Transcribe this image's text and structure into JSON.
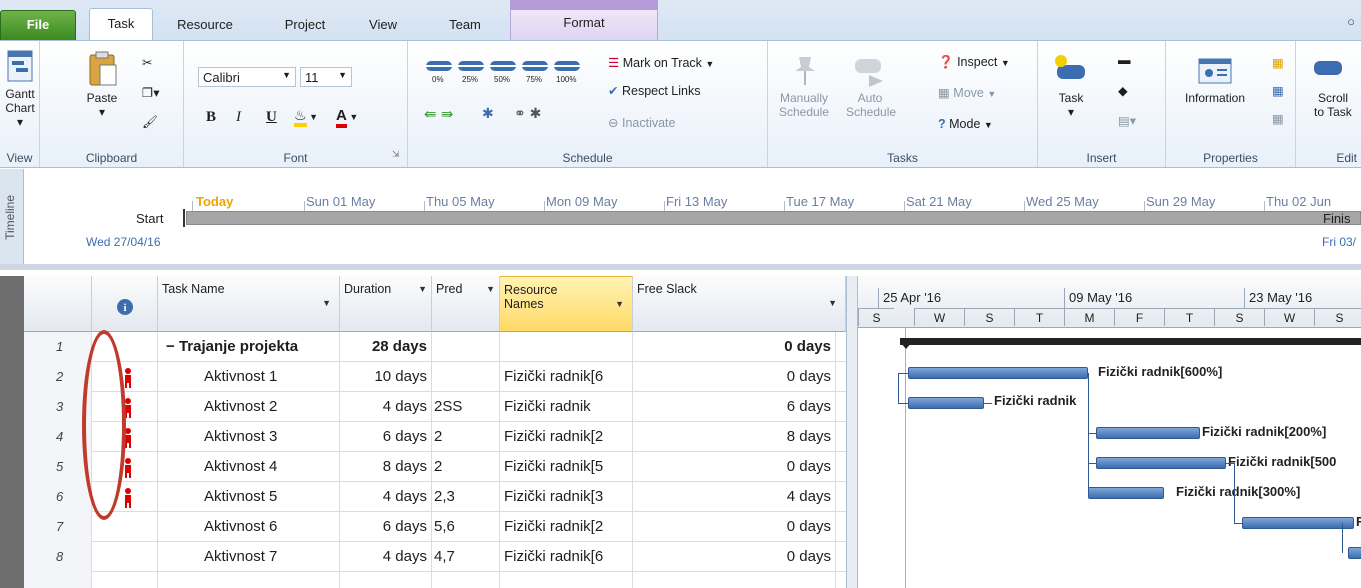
{
  "tabs": {
    "file": "File",
    "task": "Task",
    "resource": "Resource",
    "project": "Project",
    "view": "View",
    "team": "Team",
    "format": "Format"
  },
  "ribbon": {
    "view": {
      "gantt_line1": "Gantt",
      "gantt_line2": "Chart ▾",
      "label": "View"
    },
    "clipboard": {
      "paste": "Paste",
      "paste_arrow": "▾",
      "label": "Clipboard"
    },
    "font": {
      "name": "Calibri",
      "size": "11",
      "bold": "B",
      "italic": "I",
      "underline": "U",
      "color_a": "A",
      "label": "Font"
    },
    "schedule": {
      "pct": [
        "0%",
        "25%",
        "50%",
        "75%",
        "100%"
      ],
      "mark_on_track": "Mark on Track",
      "respect_links": "Respect Links",
      "inactivate": "Inactivate",
      "label": "Schedule"
    },
    "tasks": {
      "manually_line1": "Manually",
      "manually_line2": "Schedule",
      "auto_line1": "Auto",
      "auto_line2": "Schedule",
      "inspect": "Inspect",
      "move": "Move",
      "mode": "Mode",
      "label": "Tasks"
    },
    "insert": {
      "task": "Task",
      "task_arrow": "▾",
      "label": "Insert"
    },
    "properties": {
      "information": "Information",
      "label": "Properties"
    },
    "editing": {
      "scroll_line1": "Scroll",
      "scroll_line2": "to Task",
      "label": "Edit"
    }
  },
  "timeline": {
    "side_label": "Timeline",
    "start_label": "Start",
    "start_date": "Wed 27/04/16",
    "finish_label": "Finis",
    "finish_date": "Fri 03/",
    "today": "Today",
    "dates": [
      "Sun 01 May",
      "Thu 05 May",
      "Mon 09 May",
      "Fri 13 May",
      "Tue 17 May",
      "Sat 21 May",
      "Wed 25 May",
      "Sun 29 May",
      "Thu 02 Jun"
    ]
  },
  "grid": {
    "headers": {
      "task_name": "Task Name",
      "duration": "Duration",
      "pred": "Pred",
      "resource_line1": "Resource",
      "resource_line2": "Names",
      "free_slack": "Free Slack"
    },
    "rows": [
      {
        "id": "1",
        "name": "Trajanje projekta",
        "duration": "28 days",
        "pred": "",
        "resource": "",
        "slack": "0 days",
        "summary": true,
        "collapse": "−"
      },
      {
        "id": "2",
        "name": "Aktivnost 1",
        "duration": "10 days",
        "pred": "",
        "resource": "Fizički radnik[6",
        "slack": "0 days"
      },
      {
        "id": "3",
        "name": "Aktivnost 2",
        "duration": "4 days",
        "pred": "2SS",
        "resource": "Fizički radnik",
        "slack": "6 days"
      },
      {
        "id": "4",
        "name": "Aktivnost 3",
        "duration": "6 days",
        "pred": "2",
        "resource": "Fizički radnik[2",
        "slack": "8 days"
      },
      {
        "id": "5",
        "name": "Aktivnost 4",
        "duration": "8 days",
        "pred": "2",
        "resource": "Fizički radnik[5",
        "slack": "0 days"
      },
      {
        "id": "6",
        "name": "Aktivnost 5",
        "duration": "4 days",
        "pred": "2,3",
        "resource": "Fizički radnik[3",
        "slack": "4 days"
      },
      {
        "id": "7",
        "name": "Aktivnost 6",
        "duration": "6 days",
        "pred": "5,6",
        "resource": "Fizički radnik[2",
        "slack": "0 days"
      },
      {
        "id": "8",
        "name": "Aktivnost 7",
        "duration": "4 days",
        "pred": "4,7",
        "resource": "Fizički radnik[6",
        "slack": "0 days"
      }
    ]
  },
  "gantt": {
    "weeks": [
      "25 Apr '16",
      "09 May '16",
      "23 May '16"
    ],
    "days": [
      "S",
      "W",
      "S",
      "T",
      "M",
      "F",
      "T",
      "S",
      "W",
      "S"
    ],
    "labels": [
      "Fizički radnik[600%]",
      "Fizički radnik",
      "Fizički radnik[200%]",
      "Fizički radnik[500",
      "Fizički radnik[300%]",
      "F"
    ]
  },
  "colors": {
    "accent": "#3c6db0",
    "file_tab": "#3a8a20",
    "today": "#f2a300",
    "resource_highlight": "#ffd966",
    "annotation": "#c0392b"
  }
}
